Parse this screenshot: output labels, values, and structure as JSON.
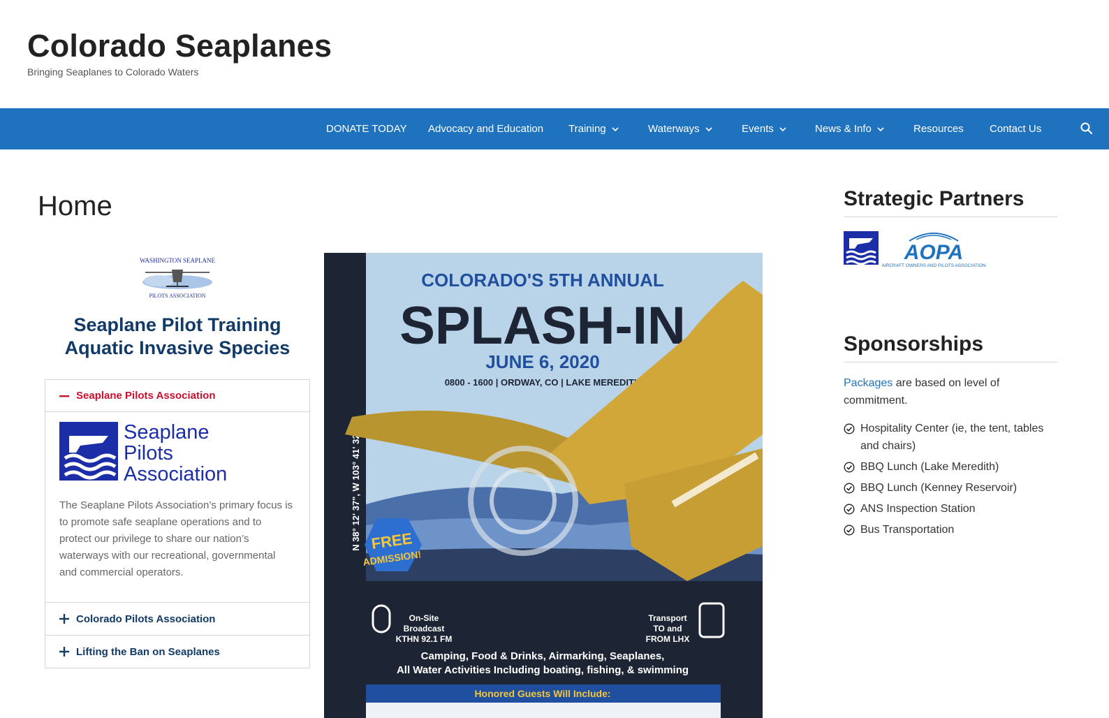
{
  "site": {
    "title": "Colorado Seaplanes",
    "tagline": "Bringing Seaplanes to Colorado Waters"
  },
  "nav": {
    "items": [
      {
        "label": "DONATE TODAY",
        "has_dropdown": false
      },
      {
        "label": "Advocacy and Education",
        "has_dropdown": false
      },
      {
        "label": "Training",
        "has_dropdown": true
      },
      {
        "label": "Waterways",
        "has_dropdown": true
      },
      {
        "label": "Events",
        "has_dropdown": true
      },
      {
        "label": "News & Info",
        "has_dropdown": true
      },
      {
        "label": "Resources",
        "has_dropdown": false
      },
      {
        "label": "Contact Us",
        "has_dropdown": false
      }
    ],
    "search_icon": "search-icon",
    "background": "#1f73be"
  },
  "main": {
    "page_title": "Home",
    "wspa_logo": {
      "line1": "WASHINGTON SEAPLANE",
      "line2": "PILOTS ASSOCIATION"
    },
    "heading_training": "Seaplane Pilot Training",
    "heading_aquatic": "Aquatic Invasive Species",
    "accordion": [
      {
        "title": "Seaplane Pilots Association",
        "open": true,
        "logo_text": [
          "Seaplane",
          "Pilots",
          "Association"
        ],
        "body": "The Seaplane Pilots Association’s primary focus is to promote safe seaplane operations and to protect our privilege to share our nation’s waterways with our recreational, governmental and commercial operators."
      },
      {
        "title": "Colorado Pilots Association",
        "open": false
      },
      {
        "title": "Lifting the Ban on Seaplanes",
        "open": false
      }
    ],
    "poster": {
      "coords": "N 38° 12' 37\", W 103° 41' 32\"",
      "headline_small": "COLORADO'S 5TH ANNUAL",
      "headline": "SPLASH-IN",
      "date": "JUNE 6, 2020",
      "details": "0800 - 1600 | ORDWAY, CO | LAKE MEREDITH",
      "badge_line1": "FREE",
      "badge_line2": "ADMISSION!",
      "broadcast": [
        "On-Site",
        "Broadcast",
        "KTHN 92.1 FM"
      ],
      "transport": [
        "Transport",
        "TO and",
        "FROM LHX"
      ],
      "activities_line1": "Camping, Food & Drinks, Airmarking, Seaplanes,",
      "activities_line2": "All Water Activities Including boating, fishing, & swimming",
      "guests_header": "Honored Guests Will Include:"
    }
  },
  "sidebar": {
    "partners_title": "Strategic Partners",
    "aopa_text": "AOPA",
    "aopa_subtext": "AIRCRAFT OWNERS AND PILOTS ASSOCIATION",
    "sponsorships_title": "Sponsorships",
    "packages_link": "Packages",
    "packages_text": " are based on level of commitment.",
    "sponsor_items": [
      "Hospitality Center (ie, the tent, tables and chairs)",
      "BBQ Lunch (Lake Meredith)",
      "BBQ Lunch (Kenney Reservoir)",
      "ANS Inspection Station",
      "Bus Transportation"
    ]
  },
  "colors": {
    "accent": "#1f73be",
    "heading_blue": "#123a66",
    "accordion_active": "#c8102e",
    "spa_blue": "#1b2ea8"
  }
}
